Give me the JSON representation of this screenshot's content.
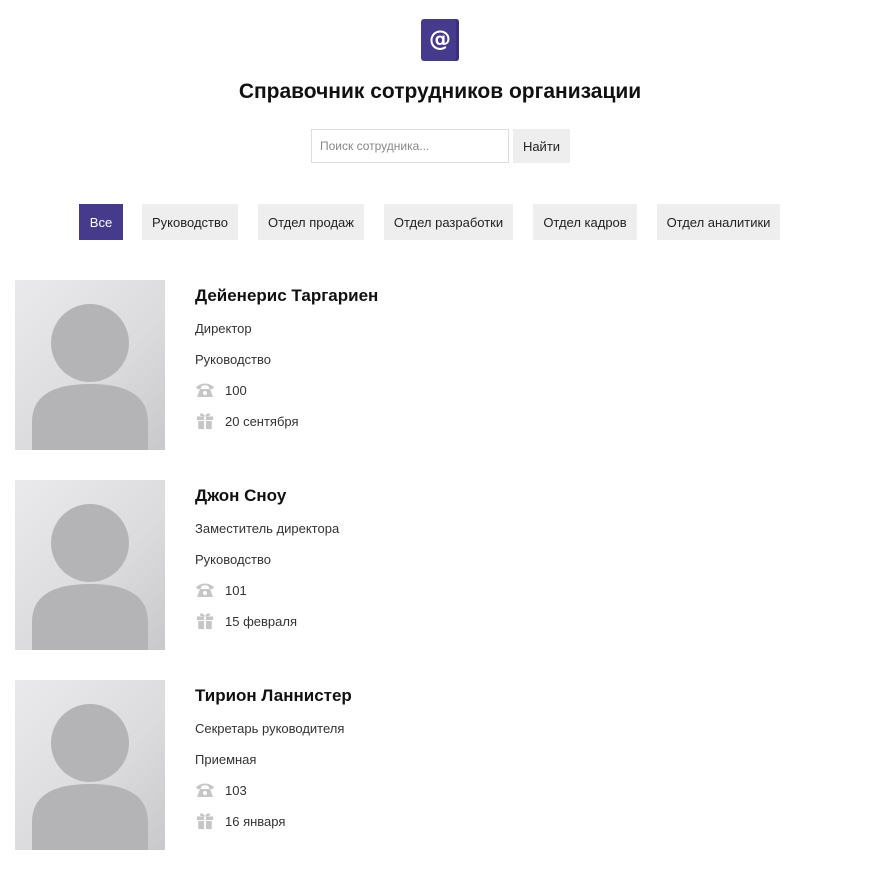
{
  "logo": {
    "glyph": "@",
    "icon": "at-sign-icon",
    "color": "#463a8c"
  },
  "title": "Справочник сотрудников организации",
  "search": {
    "placeholder": "Поиск сотрудника...",
    "value": "",
    "button_label": "Найти"
  },
  "filters": [
    {
      "label": "Все",
      "active": true
    },
    {
      "label": "Руководство",
      "active": false
    },
    {
      "label": "Отдел продаж",
      "active": false
    },
    {
      "label": "Отдел разработки",
      "active": false
    },
    {
      "label": "Отдел кадров",
      "active": false
    },
    {
      "label": "Отдел аналитики",
      "active": false
    }
  ],
  "employees": [
    {
      "name": "Дейенерис Таргариен",
      "position": "Директор",
      "department": "Руководство",
      "phone": "100",
      "birthday": "20 сентября"
    },
    {
      "name": "Джон Сноу",
      "position": "Заместитель директора",
      "department": "Руководство",
      "phone": "101",
      "birthday": "15 февраля"
    },
    {
      "name": "Тирион Ланнистер",
      "position": "Секретарь руководителя",
      "department": "Приемная",
      "phone": "103",
      "birthday": "16 января"
    }
  ],
  "icons": {
    "phone": "phone-icon",
    "birthday": "gift-icon",
    "avatar": "user-silhouette-icon"
  },
  "colors": {
    "accent": "#463a8c",
    "button_bg": "#eeeeee",
    "icon_gray": "#c6c6c6"
  }
}
